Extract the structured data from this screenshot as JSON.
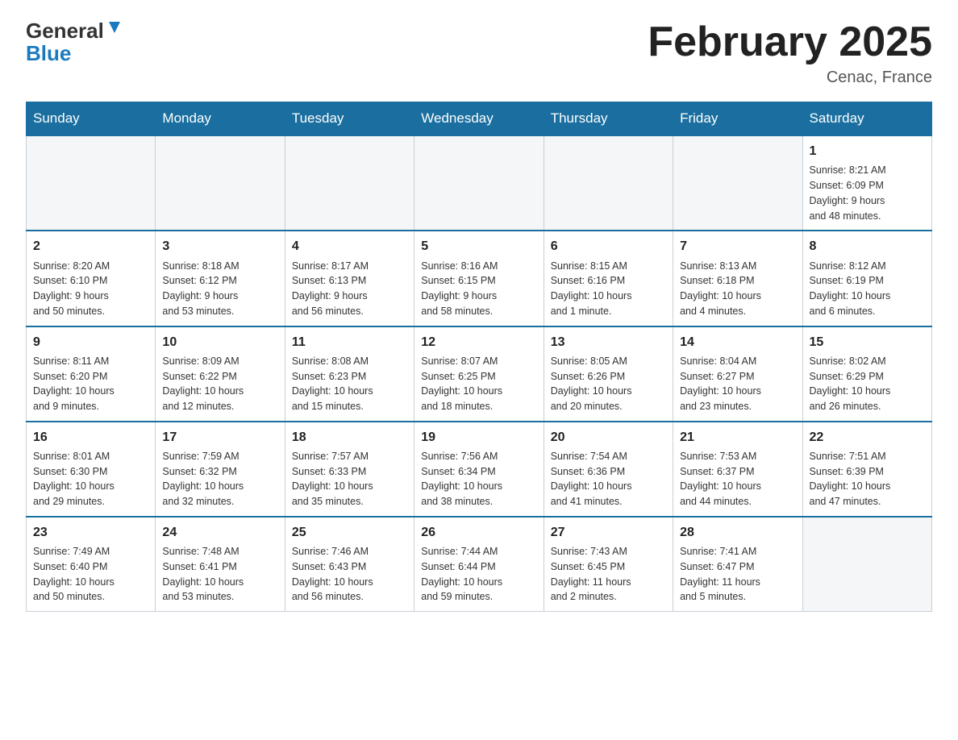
{
  "logo": {
    "part1": "General",
    "part2": "Blue"
  },
  "title": "February 2025",
  "subtitle": "Cenac, France",
  "days_of_week": [
    "Sunday",
    "Monday",
    "Tuesday",
    "Wednesday",
    "Thursday",
    "Friday",
    "Saturday"
  ],
  "weeks": [
    [
      {
        "day": "",
        "info": ""
      },
      {
        "day": "",
        "info": ""
      },
      {
        "day": "",
        "info": ""
      },
      {
        "day": "",
        "info": ""
      },
      {
        "day": "",
        "info": ""
      },
      {
        "day": "",
        "info": ""
      },
      {
        "day": "1",
        "info": "Sunrise: 8:21 AM\nSunset: 6:09 PM\nDaylight: 9 hours\nand 48 minutes."
      }
    ],
    [
      {
        "day": "2",
        "info": "Sunrise: 8:20 AM\nSunset: 6:10 PM\nDaylight: 9 hours\nand 50 minutes."
      },
      {
        "day": "3",
        "info": "Sunrise: 8:18 AM\nSunset: 6:12 PM\nDaylight: 9 hours\nand 53 minutes."
      },
      {
        "day": "4",
        "info": "Sunrise: 8:17 AM\nSunset: 6:13 PM\nDaylight: 9 hours\nand 56 minutes."
      },
      {
        "day": "5",
        "info": "Sunrise: 8:16 AM\nSunset: 6:15 PM\nDaylight: 9 hours\nand 58 minutes."
      },
      {
        "day": "6",
        "info": "Sunrise: 8:15 AM\nSunset: 6:16 PM\nDaylight: 10 hours\nand 1 minute."
      },
      {
        "day": "7",
        "info": "Sunrise: 8:13 AM\nSunset: 6:18 PM\nDaylight: 10 hours\nand 4 minutes."
      },
      {
        "day": "8",
        "info": "Sunrise: 8:12 AM\nSunset: 6:19 PM\nDaylight: 10 hours\nand 6 minutes."
      }
    ],
    [
      {
        "day": "9",
        "info": "Sunrise: 8:11 AM\nSunset: 6:20 PM\nDaylight: 10 hours\nand 9 minutes."
      },
      {
        "day": "10",
        "info": "Sunrise: 8:09 AM\nSunset: 6:22 PM\nDaylight: 10 hours\nand 12 minutes."
      },
      {
        "day": "11",
        "info": "Sunrise: 8:08 AM\nSunset: 6:23 PM\nDaylight: 10 hours\nand 15 minutes."
      },
      {
        "day": "12",
        "info": "Sunrise: 8:07 AM\nSunset: 6:25 PM\nDaylight: 10 hours\nand 18 minutes."
      },
      {
        "day": "13",
        "info": "Sunrise: 8:05 AM\nSunset: 6:26 PM\nDaylight: 10 hours\nand 20 minutes."
      },
      {
        "day": "14",
        "info": "Sunrise: 8:04 AM\nSunset: 6:27 PM\nDaylight: 10 hours\nand 23 minutes."
      },
      {
        "day": "15",
        "info": "Sunrise: 8:02 AM\nSunset: 6:29 PM\nDaylight: 10 hours\nand 26 minutes."
      }
    ],
    [
      {
        "day": "16",
        "info": "Sunrise: 8:01 AM\nSunset: 6:30 PM\nDaylight: 10 hours\nand 29 minutes."
      },
      {
        "day": "17",
        "info": "Sunrise: 7:59 AM\nSunset: 6:32 PM\nDaylight: 10 hours\nand 32 minutes."
      },
      {
        "day": "18",
        "info": "Sunrise: 7:57 AM\nSunset: 6:33 PM\nDaylight: 10 hours\nand 35 minutes."
      },
      {
        "day": "19",
        "info": "Sunrise: 7:56 AM\nSunset: 6:34 PM\nDaylight: 10 hours\nand 38 minutes."
      },
      {
        "day": "20",
        "info": "Sunrise: 7:54 AM\nSunset: 6:36 PM\nDaylight: 10 hours\nand 41 minutes."
      },
      {
        "day": "21",
        "info": "Sunrise: 7:53 AM\nSunset: 6:37 PM\nDaylight: 10 hours\nand 44 minutes."
      },
      {
        "day": "22",
        "info": "Sunrise: 7:51 AM\nSunset: 6:39 PM\nDaylight: 10 hours\nand 47 minutes."
      }
    ],
    [
      {
        "day": "23",
        "info": "Sunrise: 7:49 AM\nSunset: 6:40 PM\nDaylight: 10 hours\nand 50 minutes."
      },
      {
        "day": "24",
        "info": "Sunrise: 7:48 AM\nSunset: 6:41 PM\nDaylight: 10 hours\nand 53 minutes."
      },
      {
        "day": "25",
        "info": "Sunrise: 7:46 AM\nSunset: 6:43 PM\nDaylight: 10 hours\nand 56 minutes."
      },
      {
        "day": "26",
        "info": "Sunrise: 7:44 AM\nSunset: 6:44 PM\nDaylight: 10 hours\nand 59 minutes."
      },
      {
        "day": "27",
        "info": "Sunrise: 7:43 AM\nSunset: 6:45 PM\nDaylight: 11 hours\nand 2 minutes."
      },
      {
        "day": "28",
        "info": "Sunrise: 7:41 AM\nSunset: 6:47 PM\nDaylight: 11 hours\nand 5 minutes."
      },
      {
        "day": "",
        "info": ""
      }
    ]
  ]
}
